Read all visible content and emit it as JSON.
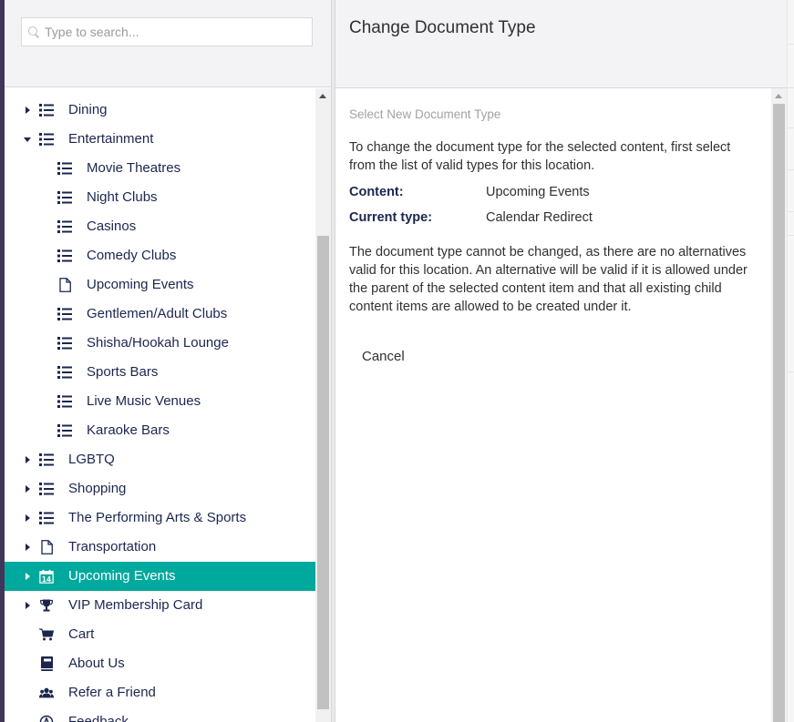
{
  "search": {
    "placeholder": "Type to search..."
  },
  "tree": [
    {
      "label": "Dining",
      "icon": "list-icon",
      "caret": "right",
      "level": 0
    },
    {
      "label": "Entertainment",
      "icon": "list-icon",
      "caret": "down",
      "level": 0
    },
    {
      "label": "Movie Theatres",
      "icon": "list-icon",
      "caret": "none",
      "level": 1
    },
    {
      "label": "Night Clubs",
      "icon": "list-icon",
      "caret": "none",
      "level": 1
    },
    {
      "label": "Casinos",
      "icon": "list-icon",
      "caret": "none",
      "level": 1
    },
    {
      "label": "Comedy Clubs",
      "icon": "list-icon",
      "caret": "none",
      "level": 1
    },
    {
      "label": "Upcoming Events",
      "icon": "document-icon",
      "caret": "none",
      "level": 1
    },
    {
      "label": "Gentlemen/Adult Clubs",
      "icon": "list-icon",
      "caret": "none",
      "level": 1
    },
    {
      "label": "Shisha/Hookah Lounge",
      "icon": "list-icon",
      "caret": "none",
      "level": 1
    },
    {
      "label": "Sports Bars",
      "icon": "list-icon",
      "caret": "none",
      "level": 1
    },
    {
      "label": "Live Music Venues",
      "icon": "list-icon",
      "caret": "none",
      "level": 1
    },
    {
      "label": "Karaoke Bars",
      "icon": "list-icon",
      "caret": "none",
      "level": 1
    },
    {
      "label": "LGBTQ",
      "icon": "list-icon",
      "caret": "right",
      "level": 0
    },
    {
      "label": "Shopping",
      "icon": "list-icon",
      "caret": "right",
      "level": 0
    },
    {
      "label": "The Performing Arts & Sports",
      "icon": "list-icon",
      "caret": "right",
      "level": 0
    },
    {
      "label": "Transportation",
      "icon": "document-icon",
      "caret": "right",
      "level": 0
    },
    {
      "label": "Upcoming Events",
      "icon": "calendar-icon",
      "calendar_day": "14",
      "caret": "right",
      "level": 0,
      "selected": true
    },
    {
      "label": "VIP Membership Card",
      "icon": "trophy-icon",
      "caret": "right",
      "level": 0
    },
    {
      "label": "Cart",
      "icon": "cart-icon",
      "caret": "none",
      "level": 0
    },
    {
      "label": "About Us",
      "icon": "book-icon",
      "caret": "none",
      "level": 0
    },
    {
      "label": "Refer a Friend",
      "icon": "users-icon",
      "caret": "none",
      "level": 0
    },
    {
      "label": "Feedback",
      "icon": "feedback-icon",
      "caret": "none",
      "level": 0
    }
  ],
  "dialog": {
    "title": "Change Document Type",
    "section_label": "Select New Document Type",
    "intro": "To change the document type for the selected content, first select from the list of valid types for this location.",
    "content_key": "Content:",
    "content_value": "Upcoming Events",
    "type_key": "Current type:",
    "type_value": "Calendar Redirect",
    "notice": "The document type cannot be changed, as there are no alternatives valid for this location. An alternative will be valid if it is allowed under the parent of the selected content item and that all existing child content items are allowed to be created under it.",
    "cancel_label": "Cancel"
  },
  "colors": {
    "selected_bg": "#00a99d",
    "text": "#1b264f",
    "sidebar_edge": "#413659"
  }
}
